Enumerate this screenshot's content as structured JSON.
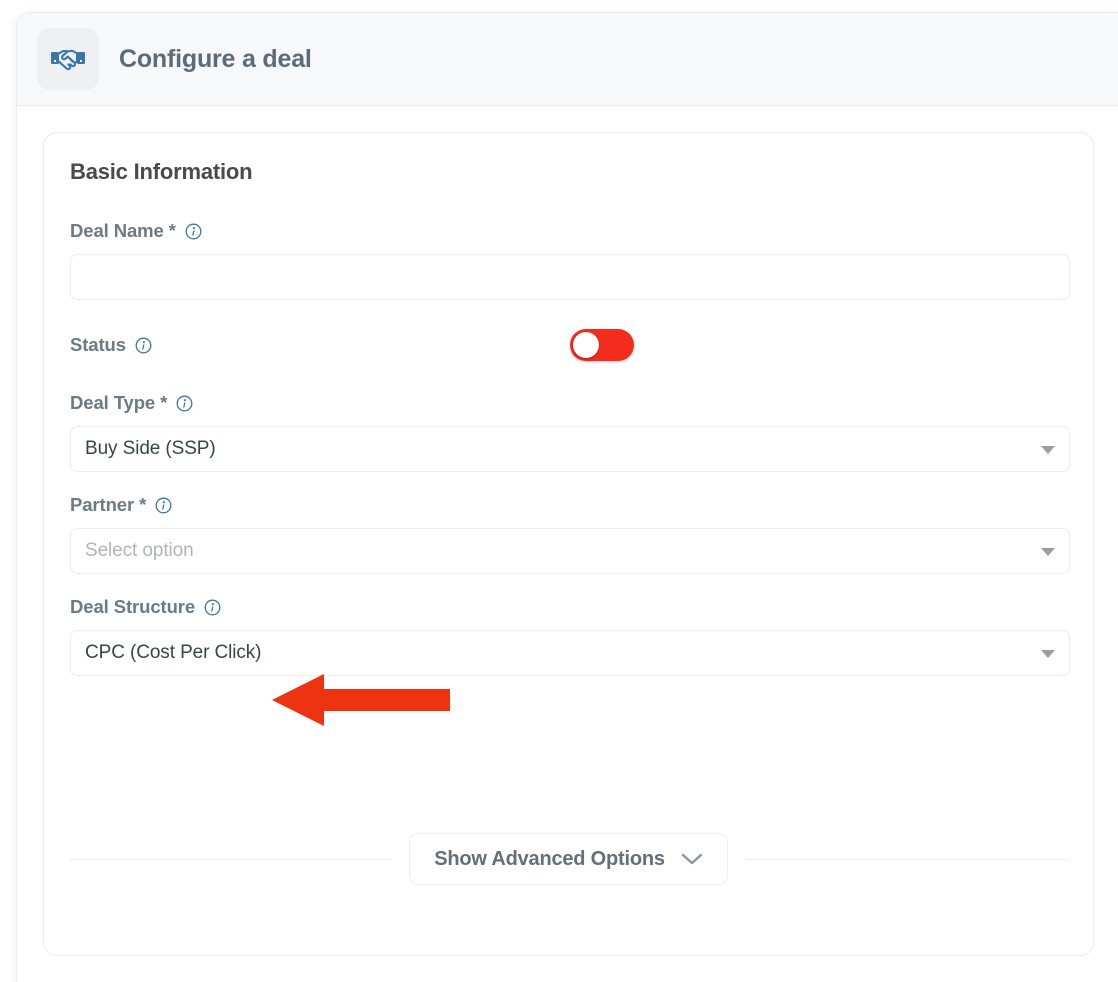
{
  "header": {
    "title": "Configure a deal",
    "icon": "handshake-icon"
  },
  "card": {
    "section_title": "Basic Information"
  },
  "fields": {
    "deal_name": {
      "label": "Deal Name",
      "required_marker": "*",
      "info_icon": "info-icon",
      "value": "",
      "placeholder": ""
    },
    "status": {
      "label": "Status",
      "info_icon": "info-icon",
      "toggle_state": "off",
      "toggle_color": "#f42c1c"
    },
    "deal_type": {
      "label": "Deal Type",
      "required_marker": "*",
      "info_icon": "info-icon",
      "value": "Buy Side (SSP)",
      "caret_icon": "caret-down-icon"
    },
    "partner": {
      "label": "Partner",
      "required_marker": "*",
      "info_icon": "info-icon",
      "value": "Select option",
      "is_placeholder": true,
      "caret_icon": "caret-down-icon"
    },
    "deal_structure": {
      "label": "Deal Structure",
      "info_icon": "info-icon",
      "value": "CPC (Cost Per Click)",
      "caret_icon": "caret-down-icon"
    }
  },
  "advanced": {
    "button_label": "Show Advanced Options",
    "chevron_icon": "chevron-down-icon"
  },
  "annotation": {
    "type": "arrow",
    "direction": "left",
    "color": "#ee3311",
    "points_at": "Deal Structure"
  },
  "colors": {
    "accent_blue": "#3a76a8",
    "label_gray": "#6b7a89",
    "toggle_red": "#f42c1c",
    "header_bg": "#f7f8f9",
    "border": "#ededf0"
  }
}
